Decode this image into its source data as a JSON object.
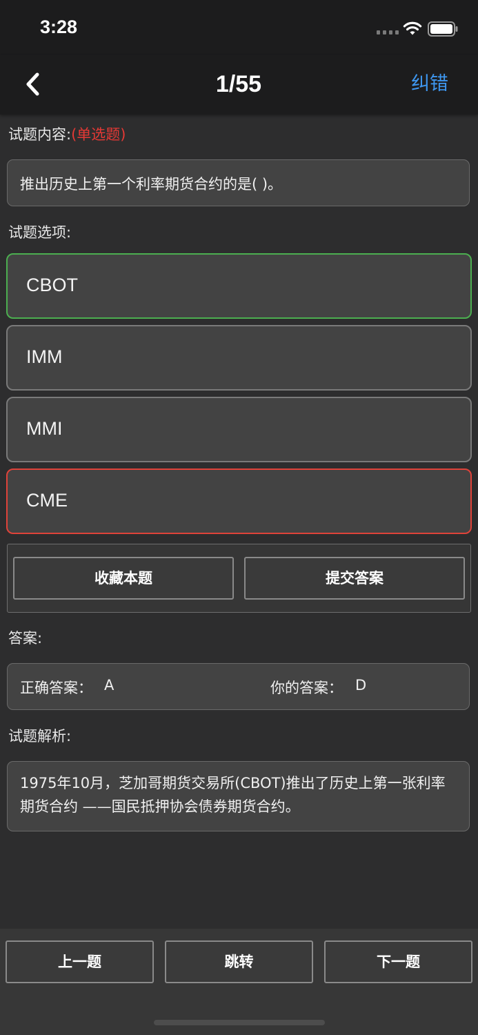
{
  "status_bar": {
    "time": "3:28",
    "icons": [
      "cellular-signal-icon",
      "wifi-icon",
      "battery-icon"
    ]
  },
  "nav": {
    "back_icon": "chevron-left-icon",
    "title": "1/55",
    "action_label": "纠错"
  },
  "question": {
    "label": "试题内容:",
    "type_tag": "(单选题)",
    "text": "推出历史上第一个利率期货合约的是( )。"
  },
  "options": {
    "label": "试题选项:",
    "items": [
      {
        "text": "CBOT",
        "state": "correct"
      },
      {
        "text": "IMM",
        "state": "normal"
      },
      {
        "text": "MMI",
        "state": "normal"
      },
      {
        "text": "CME",
        "state": "selected-wrong"
      }
    ]
  },
  "actions": {
    "favorite": "收藏本题",
    "submit": "提交答案"
  },
  "answer": {
    "label": "答案:",
    "correct_label": "正确答案：",
    "correct_value": "A",
    "yours_label": "你的答案：",
    "yours_value": "D"
  },
  "analysis": {
    "label": "试题解析:",
    "text": "1975年10月，芝加哥期货交易所(CBOT)推出了历史上第一张利率期货合约 ——国民抵押协会债券期货合约。"
  },
  "bottom_nav": {
    "prev": "上一题",
    "jump": "跳转",
    "next": "下一题"
  },
  "colors": {
    "background": "#2d2d2e",
    "bar": "#1c1c1d",
    "accent": "#3e97f0",
    "tag_red": "#e53935",
    "correct_border": "#4caf50",
    "wrong_border": "#e0433a"
  }
}
